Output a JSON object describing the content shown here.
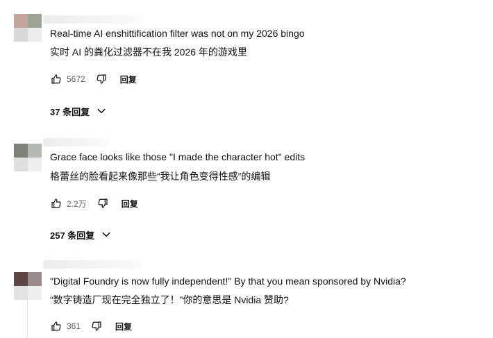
{
  "comments": [
    {
      "text_en": "Real-time AI enshittification filter was not on my 2026 bingo",
      "text_zh": "实时 AI 的粪化过滤器不在我 2026 年的游戏里",
      "likes": "5672",
      "reply_label": "回复",
      "replies_toggle": "37 条回复",
      "avatar_colors": [
        "#c4a49c",
        "#9aa394",
        "#d8d8d8",
        "#ececec"
      ]
    },
    {
      "text_en": "Grace face looks like those \"I made the character hot\" edits",
      "text_zh": "格蕾丝的脸看起来像那些“我让角色变得性感”的编辑",
      "likes": "2.2万",
      "reply_label": "回复",
      "replies_toggle": "257 条回复",
      "avatar_colors": [
        "#7b8377",
        "#b4b8b2",
        "#dedede",
        "#ededed"
      ]
    },
    {
      "text_en": "\"Digital Foundry is now fully independent!\" By that you mean sponsored by Nvidia?",
      "text_zh": "“数字铸造厂现在完全独立了！”你的意思是 Nvidia 赞助?",
      "likes": "361",
      "reply_label": "回复",
      "avatar_colors": [
        "#5c4646",
        "#9a8a8a",
        "#e2e2e2",
        "#efefef"
      ]
    }
  ],
  "icons": {
    "like": "thumbs-up-icon",
    "dislike": "thumbs-down-icon",
    "expand": "chevron-down-icon"
  }
}
